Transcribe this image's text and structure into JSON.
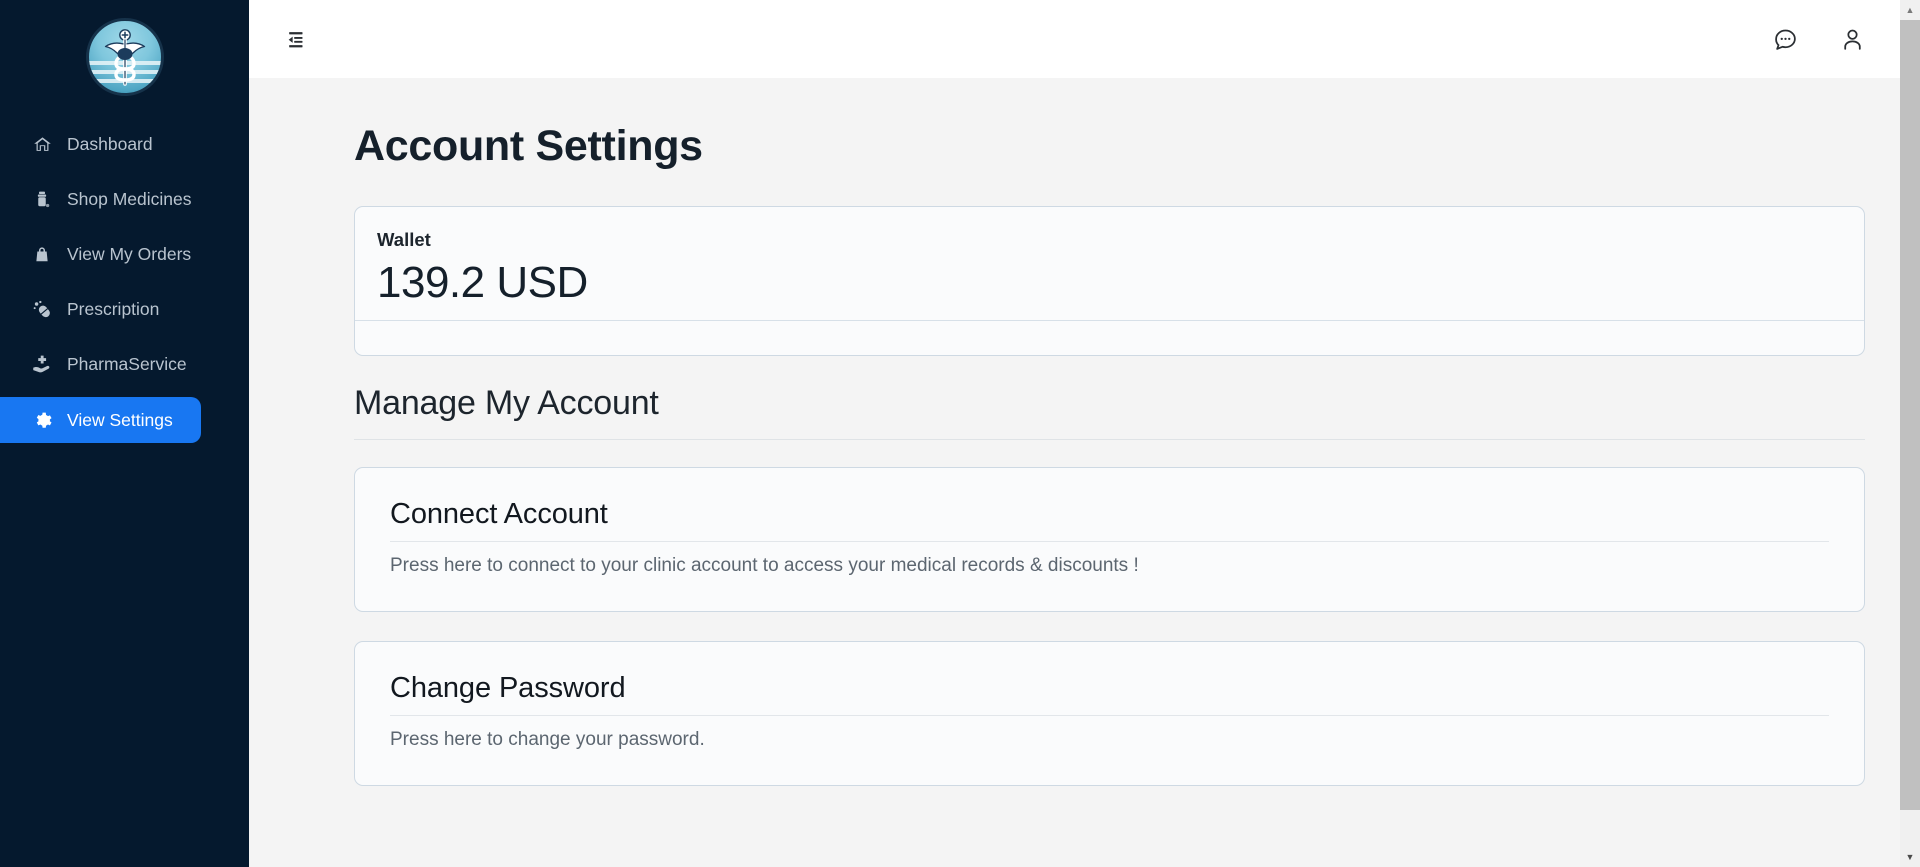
{
  "sidebar": {
    "logo_name": "caduceus-logo",
    "items": [
      {
        "label": "Dashboard",
        "icon": "home-icon",
        "active": false
      },
      {
        "label": "Shop Medicines",
        "icon": "medicine-bottle-icon",
        "active": false
      },
      {
        "label": "View My Orders",
        "icon": "shopping-bag-icon",
        "active": false
      },
      {
        "label": "Prescription",
        "icon": "pills-icon",
        "active": false
      },
      {
        "label": "PharmaService",
        "icon": "hand-plus-icon",
        "active": false
      },
      {
        "label": "View Settings",
        "icon": "gear-icon",
        "active": true
      }
    ]
  },
  "topbar": {
    "menu_toggle_icon": "sidebar-collapse-icon",
    "chat_icon": "chat-bubble-icon",
    "account_icon": "user-account-icon"
  },
  "page": {
    "title": "Account Settings"
  },
  "wallet": {
    "label": "Wallet",
    "amount": "139.2 USD"
  },
  "manage": {
    "section_title": "Manage My Account",
    "cards": [
      {
        "title": "Connect Account",
        "description": "Press here to connect to your clinic account to access your medical records & discounts !"
      },
      {
        "title": "Change Password",
        "description": "Press here to change your password."
      }
    ]
  },
  "colors": {
    "sidebar_bg": "#05192e",
    "accent_blue": "#1877f2",
    "page_bg": "#f4f4f4",
    "card_bg": "#fafbfc",
    "card_border": "#ced9e3",
    "title_text": "#15202b",
    "muted_text": "#5c6670"
  }
}
